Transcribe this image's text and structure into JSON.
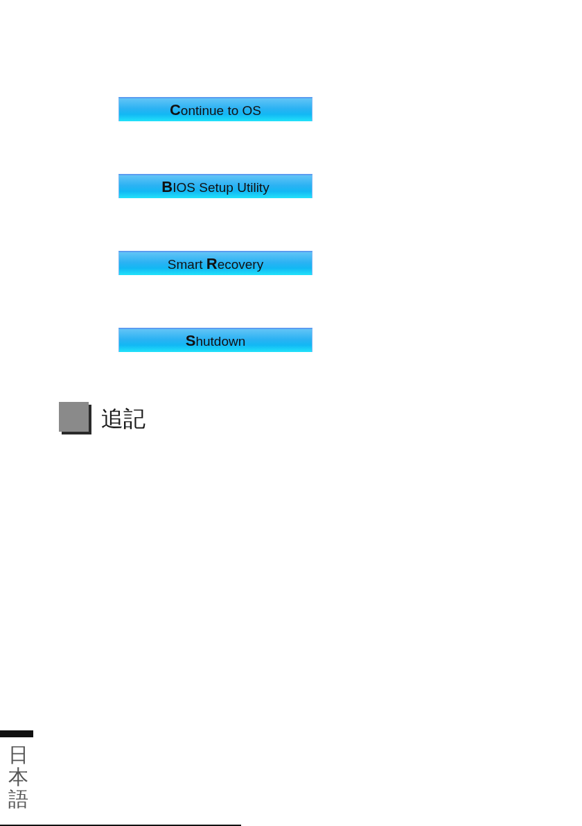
{
  "menu": {
    "buttons": [
      {
        "label": "**C**ontinue to OS"
      },
      {
        "label": "**B**IOS Setup Utility"
      },
      {
        "label": "Smart **R**ecovery"
      },
      {
        "label": "**S**hutdown"
      }
    ]
  },
  "section": {
    "title": "追記"
  },
  "side_tab": {
    "label": "日本語"
  }
}
